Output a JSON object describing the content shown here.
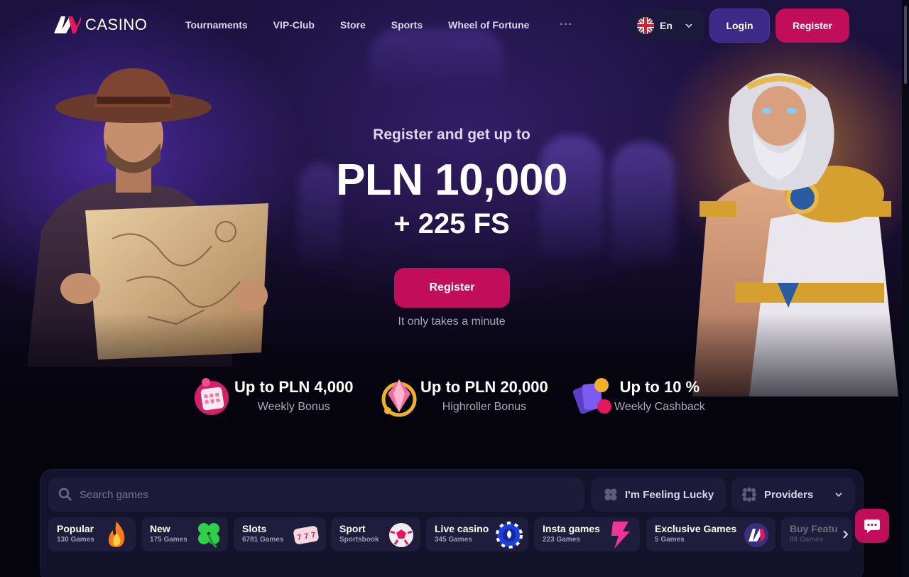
{
  "brand": {
    "logo_text": "CASINO",
    "accent": "#c20d5b",
    "login_color": "#3c2a86"
  },
  "nav": {
    "items": [
      "Tournaments",
      "VIP-Club",
      "Store",
      "Sports",
      "Wheel of Fortune"
    ],
    "more_label": "···"
  },
  "header": {
    "language": "En",
    "login_label": "Login",
    "register_label": "Register"
  },
  "hero": {
    "subtitle": "Register and get up to",
    "amount": "PLN 10,000",
    "free_spins": "+ 225 FS",
    "cta_label": "Register",
    "note": "It only takes a minute"
  },
  "bonuses": [
    {
      "title": "Up to PLN 4,000",
      "label": "Weekly Bonus",
      "icon": "calendar-gift-icon"
    },
    {
      "title": "Up to PLN 20,000",
      "label": "Highroller Bonus",
      "icon": "crystal-gem-icon"
    },
    {
      "title": "Up to 10 %",
      "label": "Weekly Cashback",
      "icon": "cards-cashback-icon"
    }
  ],
  "games": {
    "search_placeholder": "Search games",
    "lucky_label": "I'm Feeling Lucky",
    "providers_label": "Providers",
    "categories": [
      {
        "name": "Popular",
        "count": "130 Games",
        "icon": "fire-icon"
      },
      {
        "name": "New",
        "count": "175 Games",
        "icon": "clover-icon"
      },
      {
        "name": "Slots",
        "count": "6781 Games",
        "icon": "slot-reels-icon"
      },
      {
        "name": "Sport",
        "count": "Sportsbook",
        "icon": "soccer-ball-icon"
      },
      {
        "name": "Live casino",
        "count": "345 Games",
        "icon": "casino-chip-icon"
      },
      {
        "name": "Insta games",
        "count": "223 Games",
        "icon": "lightning-icon"
      },
      {
        "name": "Exclusive Games",
        "count": "5 Games",
        "icon": "av-logo-icon"
      },
      {
        "name": "Buy Featu",
        "count": "89 Games",
        "icon": "none"
      }
    ]
  }
}
